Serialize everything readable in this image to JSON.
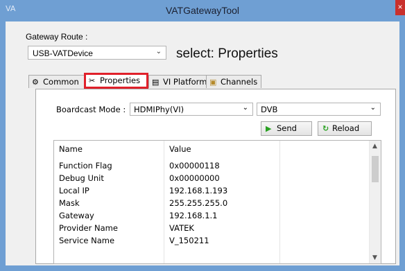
{
  "window": {
    "title": "VATGatewayTool",
    "close_glyph": "×"
  },
  "route": {
    "label": "Gateway Route :",
    "selected": "USB-VATDevice"
  },
  "select_label": "select: Properties",
  "tabs": [
    {
      "label": "Common",
      "icon": "gear-icon",
      "active": false
    },
    {
      "label": "Properties",
      "icon": "wrench-icon",
      "active": true
    },
    {
      "label": "VI Platform",
      "icon": "monitor-icon",
      "active": false
    },
    {
      "label": "Channels",
      "icon": "tv-icon",
      "active": false
    }
  ],
  "broadcast": {
    "label": "Boardcast Mode :",
    "mode": "HDMIPhy(VI)",
    "standard": "DVB"
  },
  "buttons": {
    "send": "Send",
    "reload": "Reload"
  },
  "table": {
    "headers": {
      "name": "Name",
      "value": "Value"
    },
    "rows": [
      {
        "name": "Function Flag",
        "value": "0x00000118"
      },
      {
        "name": "Debug Unit",
        "value": "0x00000000"
      },
      {
        "name": "Local IP",
        "value": "192.168.1.193"
      },
      {
        "name": "Mask",
        "value": "255.255.255.0"
      },
      {
        "name": "Gateway",
        "value": "192.168.1.1"
      },
      {
        "name": "Provider Name",
        "value": "VATEK"
      },
      {
        "name": "Service Name",
        "value": "V_150211"
      }
    ]
  },
  "colors": {
    "title_bar": "#6f9fd3",
    "highlight": "#e0202a",
    "send_green": "#28a020"
  }
}
